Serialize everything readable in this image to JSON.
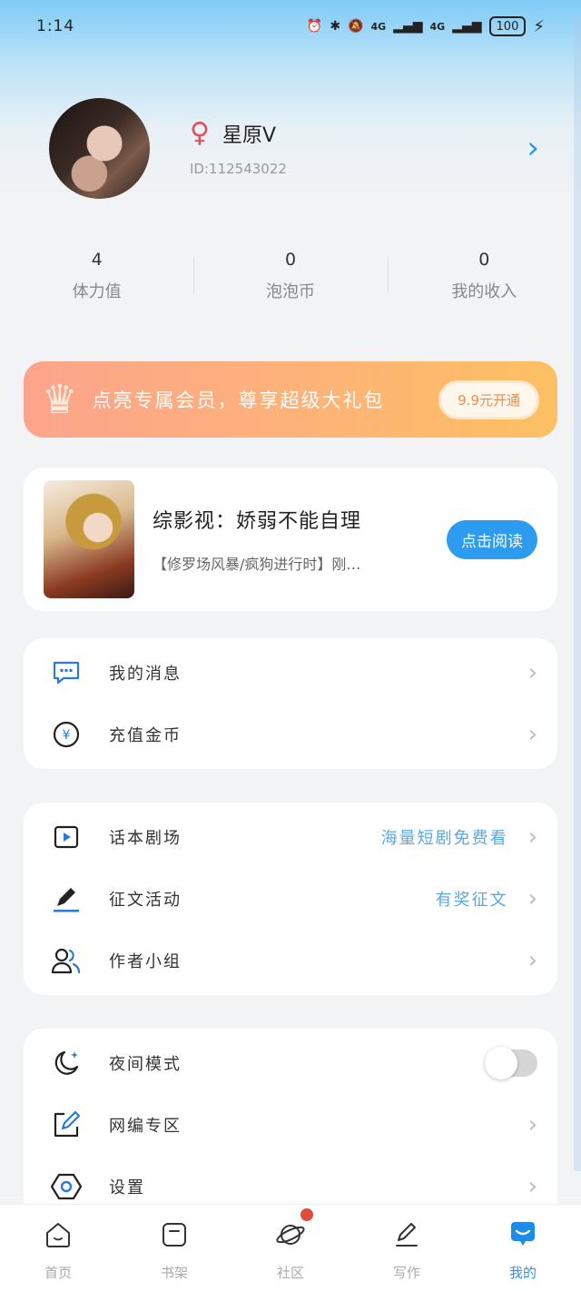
{
  "status_bar": {
    "time": "1:14",
    "network_1": "4G",
    "network_2": "4G",
    "battery": "100"
  },
  "profile": {
    "username": "星原V",
    "user_id": "ID:112543022"
  },
  "stats": [
    {
      "value": "4",
      "label": "体力值"
    },
    {
      "value": "0",
      "label": "泡泡币"
    },
    {
      "value": "0",
      "label": "我的收入"
    }
  ],
  "vip_banner": {
    "text": "点亮专属会员，尊享超级大礼包",
    "button_label": "9.9元开通"
  },
  "book": {
    "title": "综影视：娇弱不能自理",
    "description": "【修罗场风暴/疯狗进行时】刚…",
    "read_button": "点击阅读"
  },
  "menu_group_1": {
    "items": [
      {
        "label": "我的消息",
        "icon": "message-icon"
      },
      {
        "label": "充值金币",
        "icon": "coin-icon"
      }
    ]
  },
  "menu_group_2": {
    "items": [
      {
        "label": "话本剧场",
        "extra": "海量短剧免费看",
        "icon": "play-icon"
      },
      {
        "label": "征文活动",
        "extra": "有奖征文",
        "icon": "pen-icon"
      },
      {
        "label": "作者小组",
        "icon": "group-icon"
      }
    ]
  },
  "menu_group_3": {
    "items": [
      {
        "label": "夜间模式",
        "icon": "moon-icon",
        "toggle_on": false
      },
      {
        "label": "网编专区",
        "icon": "edit-icon"
      },
      {
        "label": "设置",
        "icon": "settings-icon"
      }
    ]
  },
  "bottom_nav": [
    {
      "label": "首页",
      "icon": "home-icon"
    },
    {
      "label": "书架",
      "icon": "bookshelf-icon"
    },
    {
      "label": "社区",
      "icon": "planet-icon",
      "badge": true
    },
    {
      "label": "写作",
      "icon": "write-icon"
    },
    {
      "label": "我的",
      "icon": "profile-chat-icon",
      "active": true
    }
  ],
  "colors": {
    "accent": "#2a95ee",
    "vip_gradient_start": "#fca48c",
    "vip_gradient_end": "#fdc062",
    "extra_text": "#56a9e6"
  }
}
